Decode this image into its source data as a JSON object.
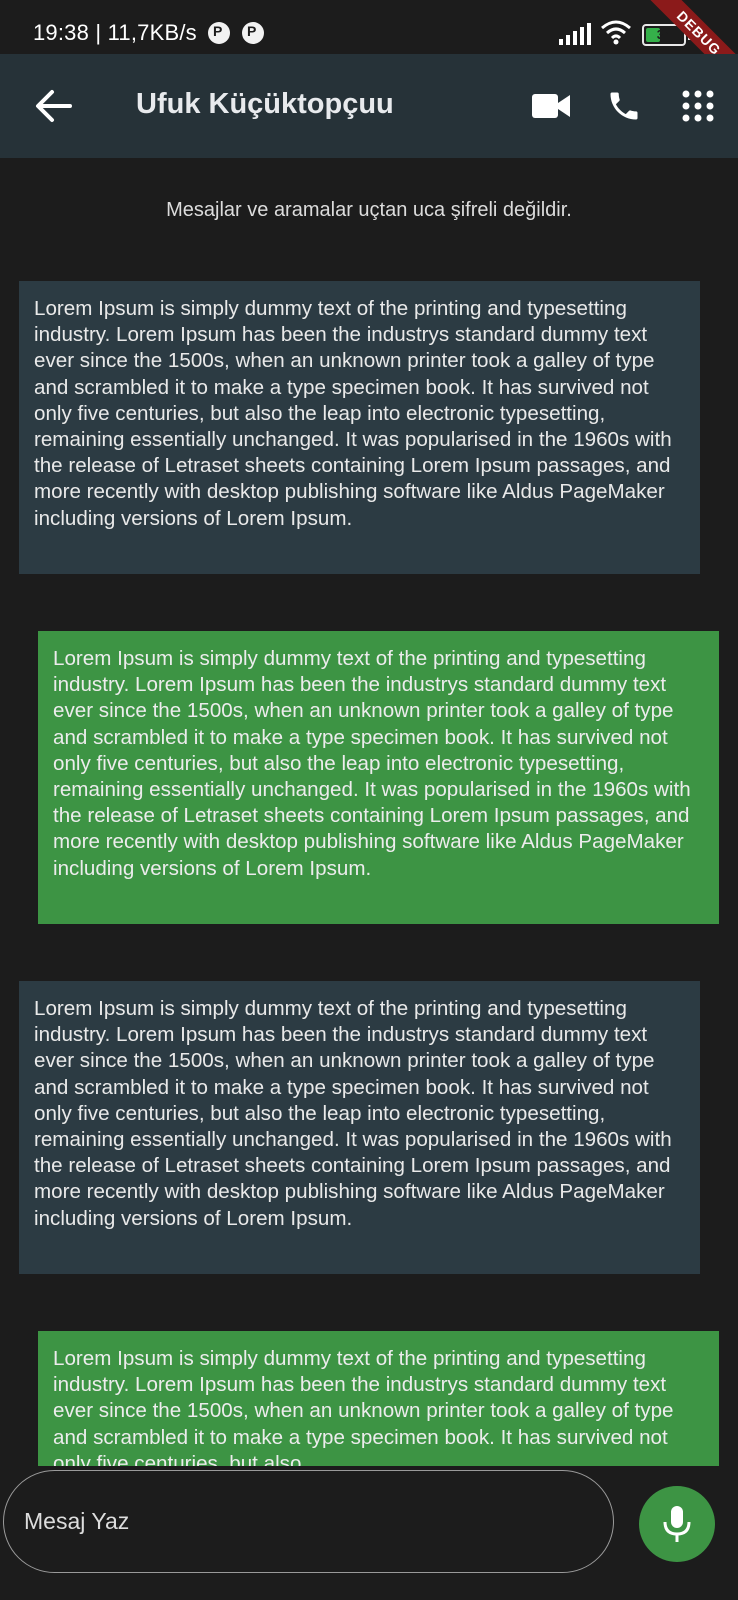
{
  "status_bar": {
    "time_speed": "19:38 | 11,7KB/s",
    "battery_level": "34",
    "icons": [
      "data-saver-icon",
      "data-saver-icon",
      "signal-icon",
      "wifi-icon",
      "battery-icon"
    ]
  },
  "debug_banner": "DEBUG",
  "header": {
    "title": "Ufuk Küçüktopçuu",
    "icons": [
      "back-arrow-icon",
      "video-camera-icon",
      "phone-icon",
      "dialpad-icon"
    ]
  },
  "chat": {
    "encryption_notice": "Mesajlar ve aramalar uçtan uca şifreli değildir.",
    "messages": [
      {
        "direction": "incoming",
        "text": "Lorem Ipsum is simply dummy text of the printing and typesetting industry. Lorem Ipsum has been the industrys standard dummy text ever since the 1500s, when an unknown printer took a galley of type and scrambled it to make a type specimen book. It has survived not only five centuries, but also the leap into electronic typesetting, remaining essentially unchanged. It was popularised in the 1960s with the release of Letraset sheets containing Lorem Ipsum passages, and more recently with desktop publishing software like Aldus PageMaker including versions of Lorem Ipsum."
      },
      {
        "direction": "outgoing",
        "text": "Lorem Ipsum is simply dummy text of the printing and typesetting industry. Lorem Ipsum has been the industrys standard dummy text ever since the 1500s, when an unknown printer took a galley of type and scrambled it to make a type specimen book. It has survived not only five centuries, but also the leap into electronic typesetting, remaining essentially unchanged. It was popularised in the 1960s with the release of Letraset sheets containing Lorem Ipsum passages, and more recently with desktop publishing software like Aldus PageMaker including versions of Lorem Ipsum."
      },
      {
        "direction": "incoming",
        "text": "Lorem Ipsum is simply dummy text of the printing and typesetting industry. Lorem Ipsum has been the industrys standard dummy text ever since the 1500s, when an unknown printer took a galley of type and scrambled it to make a type specimen book. It has survived not only five centuries, but also the leap into electronic typesetting, remaining essentially unchanged. It was popularised in the 1960s with the release of Letraset sheets containing Lorem Ipsum passages, and more recently with desktop publishing software like Aldus PageMaker including versions of Lorem Ipsum."
      },
      {
        "direction": "outgoing",
        "text": "Lorem Ipsum is simply dummy text of the printing and typesetting industry. Lorem Ipsum has been the industrys standard dummy text ever since the 1500s, when an unknown printer took a galley of type and scrambled it to make a type specimen book. It has survived not only five centuries, but also"
      }
    ]
  },
  "composer": {
    "placeholder": "Mesaj Yaz",
    "mic_icon": "microphone-icon"
  },
  "colors": {
    "background": "#1c1c1c",
    "app_bar": "#263238",
    "incoming_bubble": "#2c3b43",
    "outgoing_bubble": "#3d9444",
    "accent": "#3d9444"
  }
}
